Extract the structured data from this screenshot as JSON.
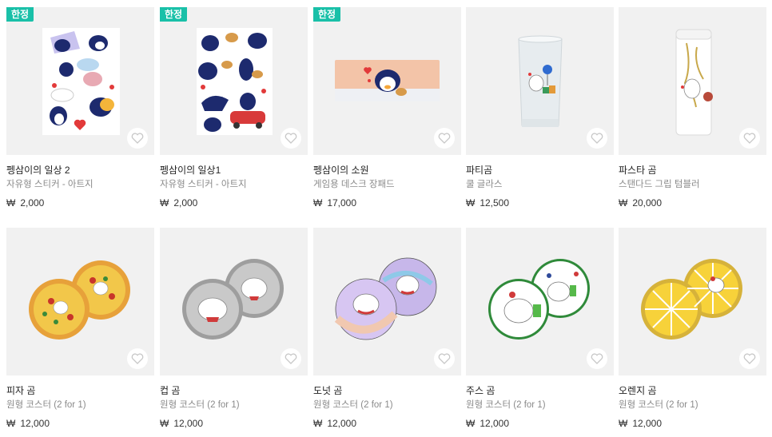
{
  "products": [
    {
      "badge": "한정",
      "title": "펭삼이의 일상 2",
      "subtitle": "자유형 스티커 - 아트지",
      "currency": "₩",
      "price": "2,000"
    },
    {
      "badge": "한정",
      "title": "펭삼이의 일상1",
      "subtitle": "자유형 스티커 - 아트지",
      "currency": "₩",
      "price": "2,000"
    },
    {
      "badge": "한정",
      "title": "펭삼이의 소원",
      "subtitle": "게임용 데스크 장패드",
      "currency": "₩",
      "price": "17,000"
    },
    {
      "badge": "",
      "title": "파티곰",
      "subtitle": "쿨 글라스",
      "currency": "₩",
      "price": "12,500"
    },
    {
      "badge": "",
      "title": "파스타 곰",
      "subtitle": "스탠다드 그립 텀블러",
      "currency": "₩",
      "price": "20,000"
    },
    {
      "badge": "",
      "title": "피자 곰",
      "subtitle": "원형 코스터 (2 for 1)",
      "currency": "₩",
      "price": "12,000"
    },
    {
      "badge": "",
      "title": "컵 곰",
      "subtitle": "원형 코스터 (2 for 1)",
      "currency": "₩",
      "price": "12,000"
    },
    {
      "badge": "",
      "title": "도넛 곰",
      "subtitle": "원형 코스터 (2 for 1)",
      "currency": "₩",
      "price": "12,000"
    },
    {
      "badge": "",
      "title": "주스 곰",
      "subtitle": "원형 코스터 (2 for 1)",
      "currency": "₩",
      "price": "12,000"
    },
    {
      "badge": "",
      "title": "오렌지 곰",
      "subtitle": "원형 코스터 (2 for 1)",
      "currency": "₩",
      "price": "12,000"
    }
  ],
  "colors": {
    "badge": "#19c0a8",
    "thumb_bg": "#f1f1f1"
  }
}
